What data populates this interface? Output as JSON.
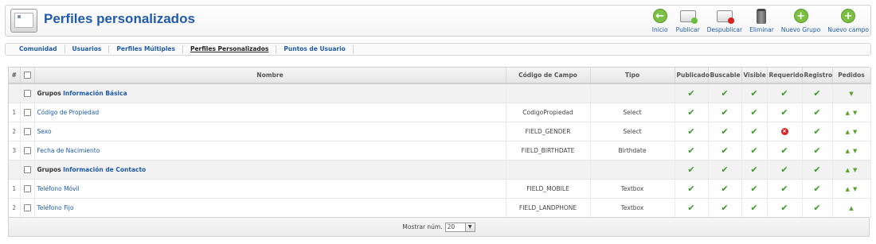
{
  "header": {
    "title": "Perfiles personalizados",
    "page_icon": "profile-window-icon",
    "toolbar": [
      {
        "id": "inicio",
        "label": "Inicio",
        "icon": "arrow-left-circle-icon"
      },
      {
        "id": "publicar",
        "label": "Publicar",
        "icon": "monitor-publish-icon"
      },
      {
        "id": "despublicar",
        "label": "Despublicar",
        "icon": "monitor-unpublish-icon"
      },
      {
        "id": "eliminar",
        "label": "Eliminar",
        "icon": "trash-icon"
      },
      {
        "id": "nuevo-grupo",
        "label": "Nuevo Grupo",
        "icon": "plus-circle-icon"
      },
      {
        "id": "nuevo-campo",
        "label": "Nuevo campo",
        "icon": "plus-circle-icon"
      }
    ]
  },
  "tabs": [
    {
      "label": "Comunidad",
      "active": false
    },
    {
      "label": "Usuarios",
      "active": false
    },
    {
      "label": "Perfiles Múltiples",
      "active": false
    },
    {
      "label": "Perfiles Personalizados",
      "active": true
    },
    {
      "label": "Puntos de Usuario",
      "active": false
    }
  ],
  "table": {
    "columns": {
      "num": "#",
      "name": "Nombre",
      "code": "Código de Campo",
      "type": "Tipo",
      "published": "Publicado",
      "searchable": "Buscable",
      "visible": "Visible",
      "required": "Requerido",
      "registration": "Registro",
      "ordering": "Pedidos"
    },
    "group_label": "Grupos",
    "groups": [
      {
        "name": "Información Básica",
        "flags": [
          true,
          true,
          true,
          true,
          true
        ],
        "ordering": [
          "down"
        ],
        "fields": [
          {
            "num": "1",
            "name": "Código de Propiedad",
            "code": "CodigoPropiedad",
            "type": "Select",
            "flags": [
              true,
              true,
              true,
              true,
              true
            ],
            "ordering": [
              "up",
              "down"
            ]
          },
          {
            "num": "2",
            "name": "Sexo",
            "code": "FIELD_GENDER",
            "type": "Select",
            "flags": [
              true,
              true,
              true,
              false,
              true
            ],
            "ordering": [
              "up",
              "down"
            ]
          },
          {
            "num": "3",
            "name": "Fecha de Nacimiento",
            "code": "FIELD_BIRTHDATE",
            "type": "Birthdate",
            "flags": [
              true,
              true,
              true,
              true,
              true
            ],
            "ordering": [
              "up",
              "down"
            ]
          }
        ]
      },
      {
        "name": "Información de Contacto",
        "flags": [
          true,
          true,
          true,
          true,
          true
        ],
        "ordering": [
          "up",
          "down"
        ],
        "fields": [
          {
            "num": "1",
            "name": "Teléfono Móvil",
            "code": "FIELD_MOBILE",
            "type": "Textbox",
            "flags": [
              true,
              true,
              true,
              true,
              true
            ],
            "ordering": [
              "up",
              "down"
            ]
          },
          {
            "num": "2",
            "name": "Teléfono Fijo",
            "code": "FIELD_LANDPHONE",
            "type": "Textbox",
            "flags": [
              true,
              true,
              true,
              true,
              true
            ],
            "ordering": [
              "up"
            ]
          }
        ]
      }
    ]
  },
  "footer": {
    "label": "Mostrar núm.",
    "value": "20"
  },
  "colors": {
    "accent": "#1f5ba8",
    "check": "#3a9a27",
    "unpublished": "#d72020"
  }
}
